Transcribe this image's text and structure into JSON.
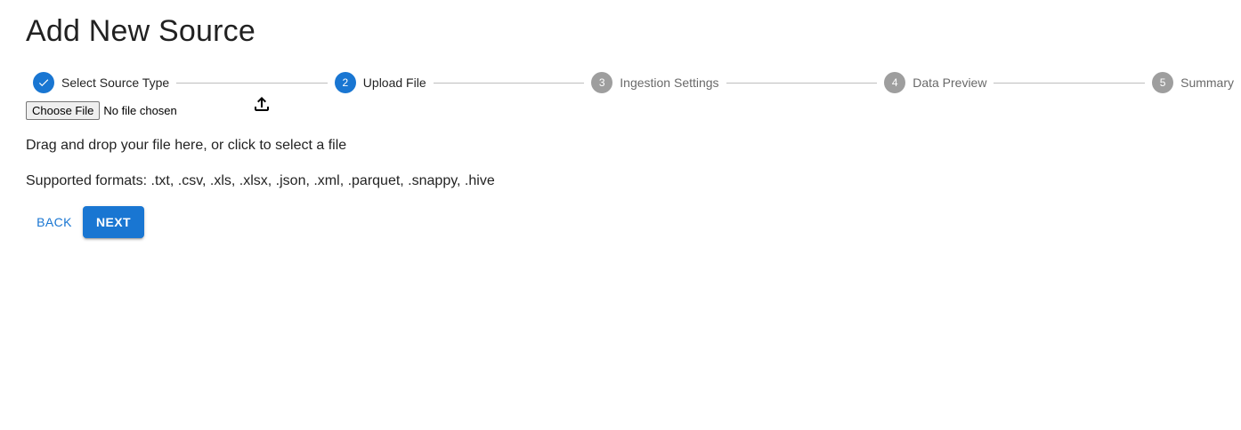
{
  "page": {
    "title": "Add New Source"
  },
  "stepper": {
    "steps": [
      {
        "number": "1",
        "label": "Select Source Type",
        "state": "completed",
        "icon": "check-icon"
      },
      {
        "number": "2",
        "label": "Upload File",
        "state": "active"
      },
      {
        "number": "3",
        "label": "Ingestion Settings",
        "state": "inactive"
      },
      {
        "number": "4",
        "label": "Data Preview",
        "state": "inactive"
      },
      {
        "number": "5",
        "label": "Summary",
        "state": "inactive"
      }
    ]
  },
  "upload": {
    "choose_file_label": "Choose File",
    "file_status": "No file chosen",
    "upload_icon": "upload-icon",
    "drag_text": "Drag and drop your file here, or click to select a file",
    "supported_formats": "Supported formats: .txt, .csv, .xls, .xlsx, .json, .xml, .parquet, .snappy, .hive"
  },
  "actions": {
    "back_label": "BACK",
    "next_label": "NEXT"
  },
  "colors": {
    "primary": "#1976d2",
    "inactive_step": "#9e9e9e",
    "connector": "#bdbdbd"
  }
}
